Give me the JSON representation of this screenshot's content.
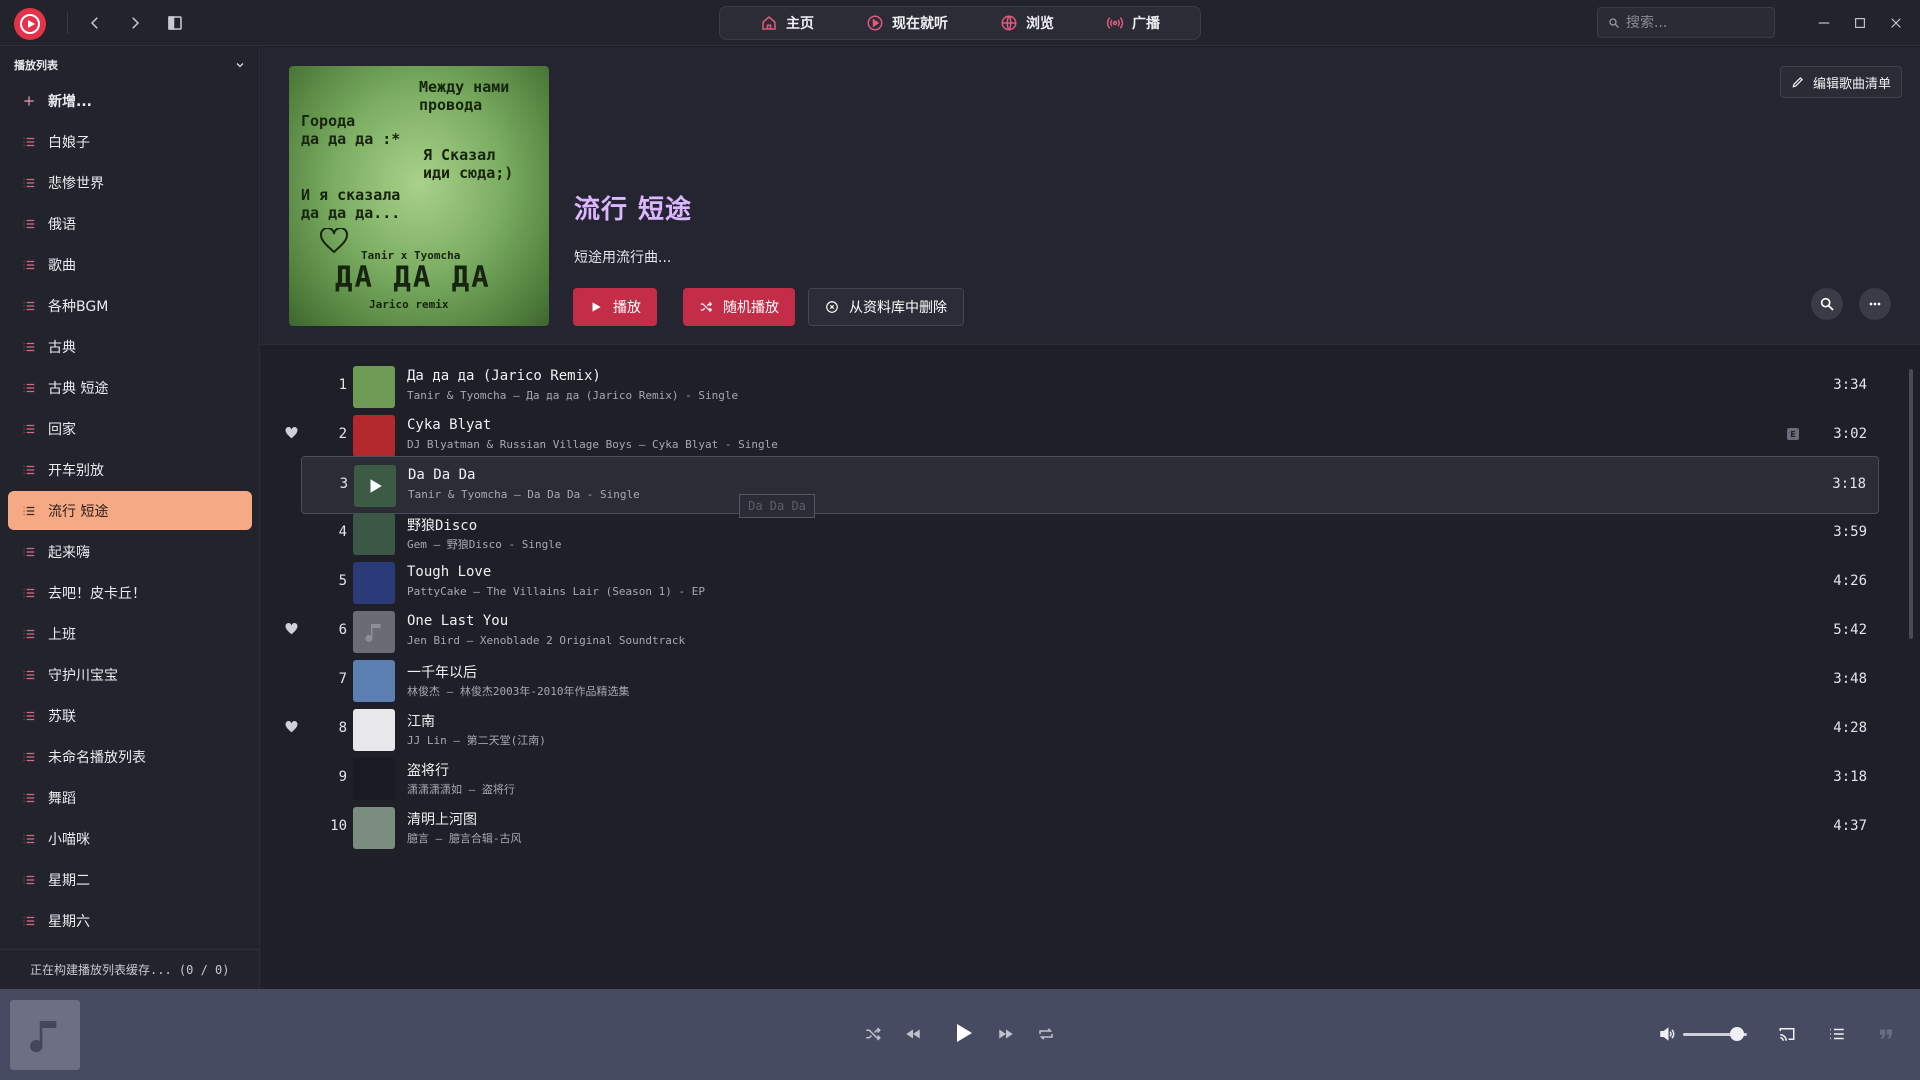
{
  "nav": {
    "items": [
      {
        "label": "主页",
        "icon": "home-icon"
      },
      {
        "label": "现在就听",
        "icon": "play-circle-icon"
      },
      {
        "label": "浏览",
        "icon": "globe-icon"
      },
      {
        "label": "广播",
        "icon": "radio-icon"
      }
    ]
  },
  "search": {
    "placeholder": "搜索..."
  },
  "sidebar": {
    "header": "播放列表",
    "add_label": "新增...",
    "items": [
      {
        "label": "白娘子"
      },
      {
        "label": "悲惨世界"
      },
      {
        "label": "俄语"
      },
      {
        "label": "歌曲"
      },
      {
        "label": "各种BGM"
      },
      {
        "label": "古典"
      },
      {
        "label": "古典 短途"
      },
      {
        "label": "回家"
      },
      {
        "label": "开车别放"
      },
      {
        "label": "流行 短途",
        "active": true
      },
      {
        "label": "起来嗨"
      },
      {
        "label": "去吧！皮卡丘！"
      },
      {
        "label": "上班"
      },
      {
        "label": "守护川宝宝"
      },
      {
        "label": "苏联"
      },
      {
        "label": "未命名播放列表"
      },
      {
        "label": "舞蹈"
      },
      {
        "label": "小喵咪"
      },
      {
        "label": "星期二"
      },
      {
        "label": "星期六"
      }
    ],
    "footer": "正在构建播放列表缓存... (0 / 0)"
  },
  "playlist": {
    "title": "流行 短途",
    "description": "短途用流行曲...",
    "play_label": "播放",
    "shuffle_label": "随机播放",
    "remove_label": "从资料库中删除",
    "edit_label": "编辑歌曲清单",
    "cover_text": {
      "line1": "Между нами\nпровода",
      "line2": "Города\nда да да :*",
      "line3": "Я Сказал\nиди сюда;)",
      "line4": "И я сказала\nда да да...",
      "artists": "Tanir x Tyomcha",
      "big": "ДА ДА ДА",
      "remix": "Jarico remix"
    }
  },
  "tracks": [
    {
      "num": "1",
      "title": "Да да да (Jarico Remix)",
      "sub": "Tanir & Tyomcha — Да да да (Jarico Remix) - Single",
      "duration": "3:34",
      "loved": false,
      "art": "#6d9a55"
    },
    {
      "num": "2",
      "title": "Cyka Blyat",
      "sub": "DJ Blyatman & Russian Village Boys — Cyka Blyat - Single",
      "duration": "3:02",
      "loved": true,
      "explicit": "E",
      "art": "#b3282d"
    },
    {
      "num": "3",
      "title": "Da Da Da",
      "sub": "Tanir & Tyomcha — Da Da Da - Single",
      "duration": "3:18",
      "loved": false,
      "art": "#3b5b45",
      "hover": true
    },
    {
      "num": "4",
      "title": "野狼Disco",
      "sub": "Gem — 野狼Disco - Single",
      "duration": "3:59",
      "loved": false,
      "art": "#3d5747"
    },
    {
      "num": "5",
      "title": "Tough Love",
      "sub": "PattyCake — The Villains Lair (Season 1) - EP",
      "duration": "4:26",
      "loved": false,
      "art": "#2b3b7a"
    },
    {
      "num": "6",
      "title": "One Last You",
      "sub": "Jen Bird — Xenoblade 2 Original Soundtrack",
      "duration": "5:42",
      "loved": true,
      "art": "#6a6b74"
    },
    {
      "num": "7",
      "title": "一千年以后",
      "sub": "林俊杰 — 林俊杰2003年-2010年作品精选集",
      "duration": "3:48",
      "loved": false,
      "art": "#5a7fb0"
    },
    {
      "num": "8",
      "title": "江南",
      "sub": "JJ Lin — 第二天堂(江南)",
      "duration": "4:28",
      "loved": true,
      "art": "#e8e8ea"
    },
    {
      "num": "9",
      "title": "盗将行",
      "sub": "潇潇潇潇如 — 盗将行",
      "duration": "3:18",
      "loved": false,
      "art": "#1a1b22"
    },
    {
      "num": "10",
      "title": "清明上河图",
      "sub": "臆言 — 臆言合辑-古风",
      "duration": "4:37",
      "loved": false,
      "art": "#7a8d80"
    }
  ],
  "drag_ghost": "Da Da Da",
  "player": {
    "volume": 0.85
  },
  "colors": {
    "accent_red": "#c42d48",
    "active_playlist": "#f6a985",
    "title_purple": "#dcb6ff",
    "player_bg": "#474b61"
  }
}
